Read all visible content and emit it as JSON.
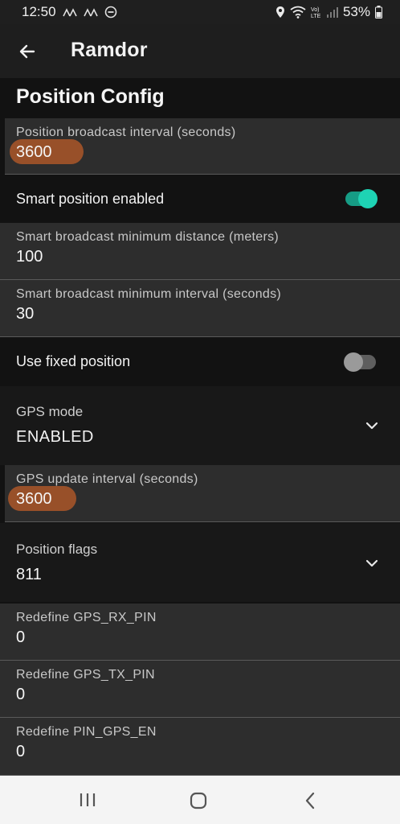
{
  "status_bar": {
    "time": "12:50",
    "battery": "53%"
  },
  "app_bar": {
    "title": "Ramdor"
  },
  "section": {
    "title": "Position Config"
  },
  "fields": {
    "broadcast_interval": {
      "label": "Position broadcast interval (seconds)",
      "value": "3600"
    },
    "smart_position": {
      "label": "Smart position enabled",
      "enabled": true
    },
    "smart_min_distance": {
      "label": "Smart broadcast minimum distance (meters)",
      "value": "100"
    },
    "smart_min_interval": {
      "label": "Smart broadcast minimum interval (seconds)",
      "value": "30"
    },
    "fixed_position": {
      "label": "Use fixed position",
      "enabled": false
    },
    "gps_mode": {
      "label": "GPS mode",
      "value": "ENABLED"
    },
    "gps_update_interval": {
      "label": "GPS update interval (seconds)",
      "value": "3600"
    },
    "position_flags": {
      "label": "Position flags",
      "value": "811"
    },
    "gps_rx_pin": {
      "label": "Redefine GPS_RX_PIN",
      "value": "0"
    },
    "gps_tx_pin": {
      "label": "Redefine GPS_TX_PIN",
      "value": "0"
    },
    "pin_gps_en": {
      "label": "Redefine PIN_GPS_EN",
      "value": "0"
    }
  },
  "colors": {
    "accent": "#1ed3b4",
    "highlight": "#b65a28"
  }
}
